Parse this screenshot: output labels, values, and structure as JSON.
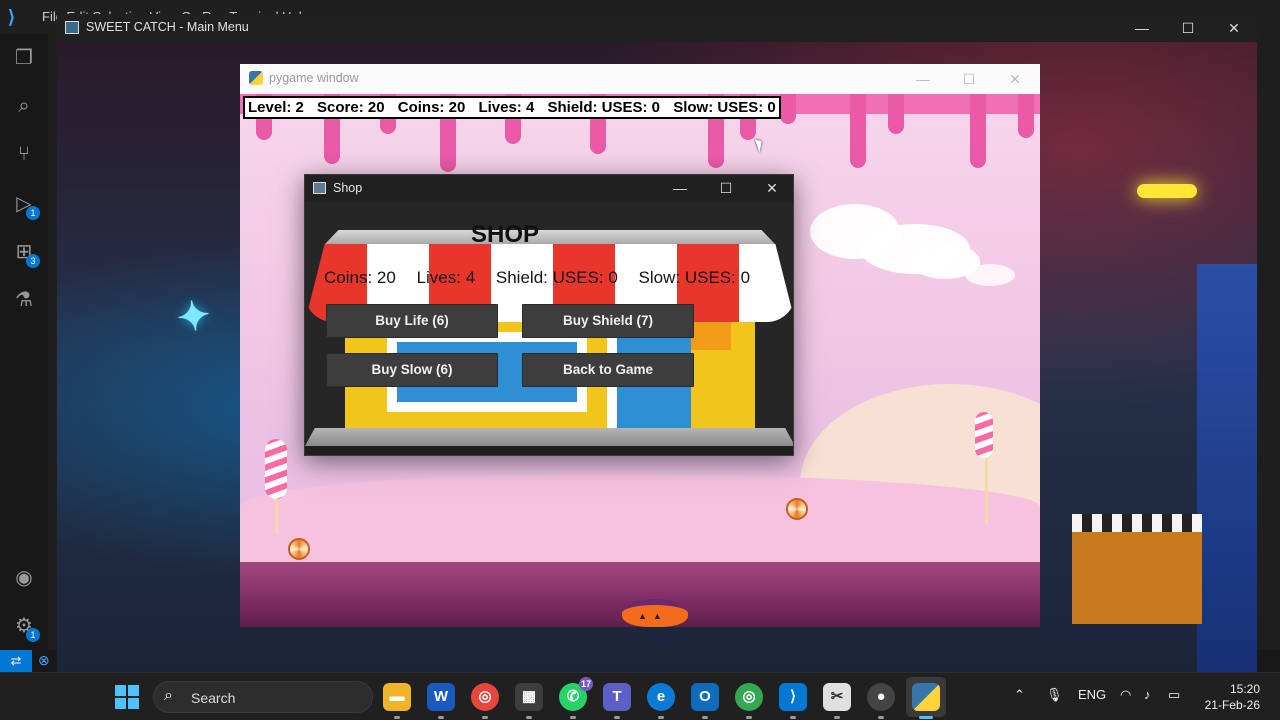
{
  "vscode": {
    "menu_text": "File  Edit  Selection  View  Go  Run  Terminal  Help",
    "activity_badges": {
      "run": "1",
      "extensions": "3",
      "settings": "1"
    }
  },
  "outer_window": {
    "title": "SWEET CATCH - Main Menu"
  },
  "pygame_window": {
    "title": "pygame window",
    "hud": {
      "level": "Level: 2",
      "score": "Score: 20",
      "coins": "Coins: 20",
      "lives": "Lives: 4",
      "shield": "Shield: USES: 0",
      "slow": "Slow: USES: 0"
    }
  },
  "shop_window": {
    "title": "Shop",
    "heading": "SHOP",
    "stats": {
      "coins": "Coins: 20",
      "lives": "Lives: 4",
      "shield": "Shield: USES: 0",
      "slow": "Slow: USES: 0"
    },
    "buttons": {
      "buy_life": "Buy Life (6)",
      "buy_shield": "Buy Shield (7)",
      "buy_slow": "Buy Slow (6)",
      "back": "Back to Game"
    }
  },
  "taskbar": {
    "search_label": "Search",
    "whatsapp_badge": "17",
    "teams_badge": "",
    "language": "ENG",
    "time": "15:20",
    "date": "21-Feb-26"
  },
  "colors": {
    "awning_red": "#e8362d",
    "store_yellow": "#f2c51a",
    "candy_pink": "#ea5aa7",
    "accent_blue": "#0078d4"
  }
}
